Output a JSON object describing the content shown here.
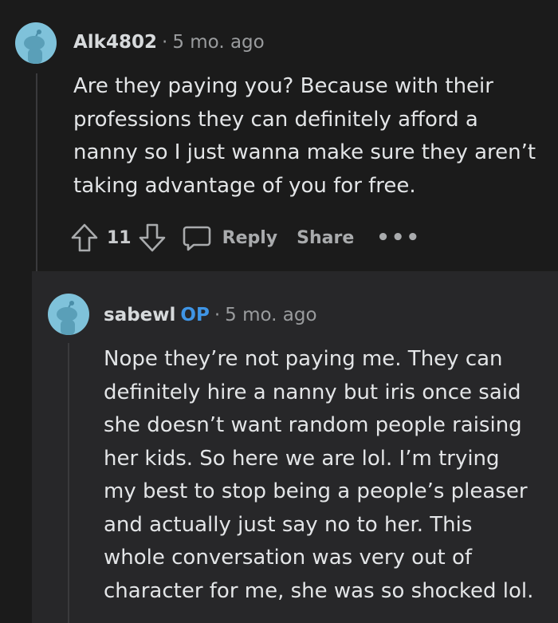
{
  "comment": {
    "username": "Alk4802",
    "separator": "·",
    "timestamp": "5 mo. ago",
    "body": "Are they paying you? Because with their professions they can definitely afford a nanny so I just wanna make sure they aren’t taking advantage of you for free.",
    "actions": {
      "upvote_icon": "upvote-arrow-icon",
      "vote_count": "11",
      "downvote_icon": "downvote-arrow-icon",
      "reply_icon": "speech-bubble-icon",
      "reply_label": "Reply",
      "share_label": "Share",
      "more_label": "•••"
    }
  },
  "reply": {
    "username": "sabewl",
    "op_badge": "OP",
    "separator": "·",
    "timestamp": "5 mo. ago",
    "body": "Nope they’re not paying me. They can definitely hire a nanny but iris once said she doesn’t want random people raising her kids. So here we are lol. I’m trying my best to stop being a people’s pleaser and actually just say no to her. This whole conversation was very out of character for me, she was so shocked lol."
  },
  "colors": {
    "background": "#1b1b1b",
    "reply_background": "#272729",
    "avatar": "#7fc2da",
    "op_badge": "#3f95e6",
    "text": "#e3e5e7",
    "muted": "#9a9c9e"
  }
}
